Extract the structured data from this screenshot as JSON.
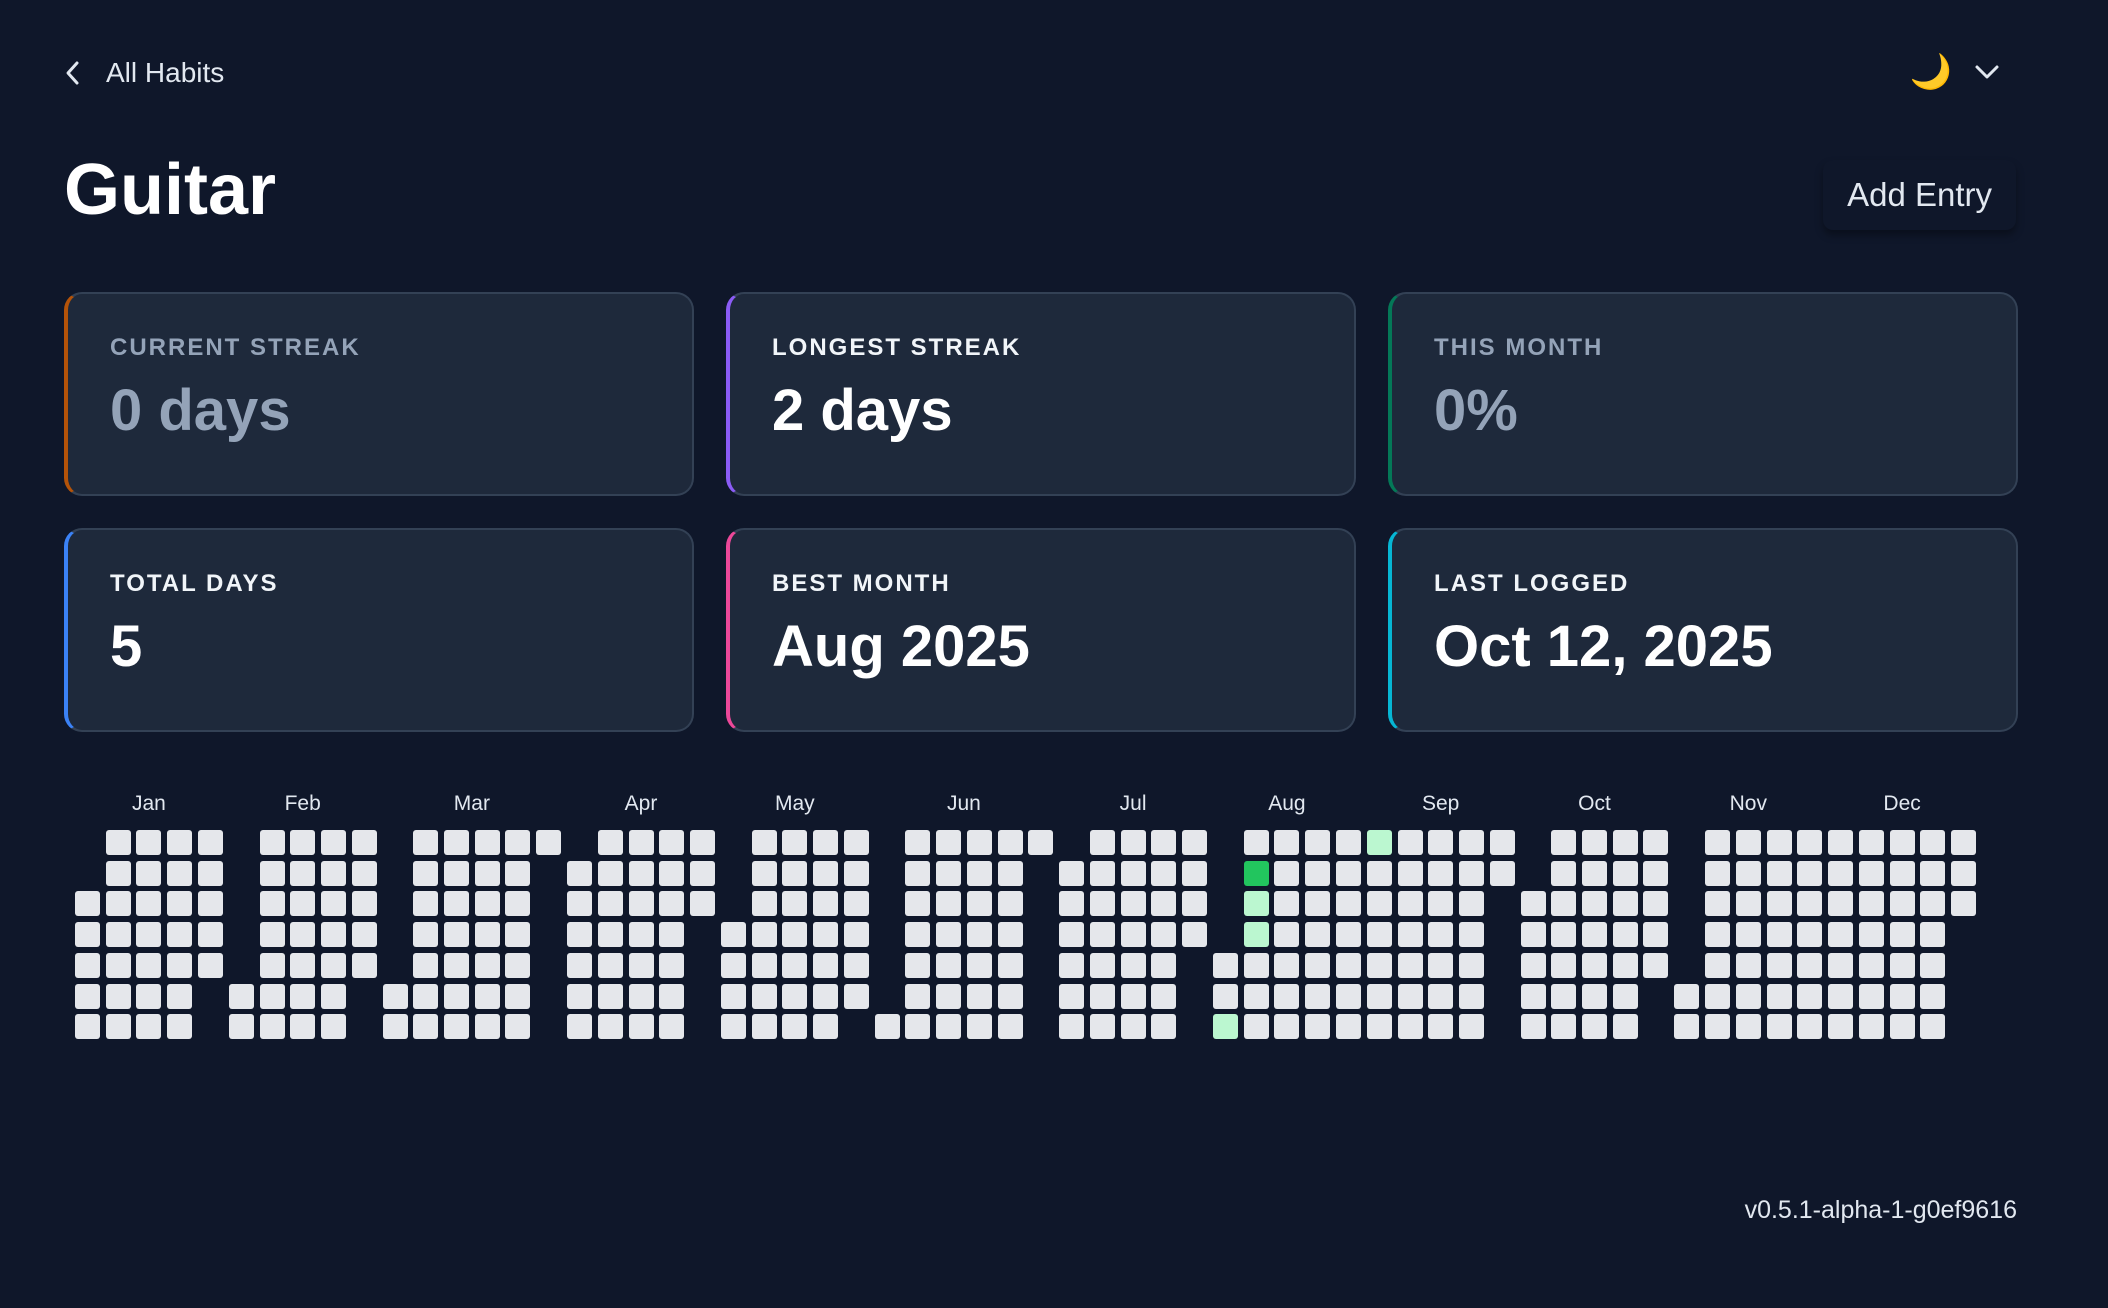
{
  "nav": {
    "back_label": "All Habits",
    "back_icon": "chevron-left-icon"
  },
  "theme": {
    "icon": "🌙",
    "icon_name": "moon-icon",
    "dropdown_icon": "chevron-down-icon"
  },
  "header": {
    "title": "Guitar",
    "add_entry_label": "Add Entry"
  },
  "stats": [
    {
      "key": "current-streak",
      "label": "CURRENT STREAK",
      "value": "0 days",
      "accent": "#b45309",
      "muted": true
    },
    {
      "key": "longest-streak",
      "label": "LONGEST STREAK",
      "value": "2 days",
      "accent": "#8b5cf6",
      "muted": false
    },
    {
      "key": "this-month",
      "label": "THIS MONTH",
      "value": "0%",
      "accent": "#047857",
      "muted": true
    },
    {
      "key": "total-days",
      "label": "TOTAL DAYS",
      "value": "5",
      "accent": "#3b82f6",
      "muted": false
    },
    {
      "key": "best-month",
      "label": "BEST MONTH",
      "value": "Aug 2025",
      "accent": "#ec4899",
      "muted": false
    },
    {
      "key": "last-logged",
      "label": "LAST LOGGED",
      "value": "Oct 12, 2025",
      "accent": "#06b6d4",
      "muted": false
    }
  ],
  "heatmap": {
    "year": 2025,
    "months": [
      "Jan",
      "Feb",
      "Mar",
      "Apr",
      "May",
      "Jun",
      "Jul",
      "Aug",
      "Sep",
      "Oct",
      "Nov",
      "Dec"
    ],
    "colors": {
      "empty": "#e5e7eb",
      "light": "#bbf7d0",
      "full": "#22c55e"
    },
    "entries": [
      {
        "date": "2025-08-03",
        "level": "light"
      },
      {
        "date": "2025-08-05",
        "level": "full"
      },
      {
        "date": "2025-08-06",
        "level": "light"
      },
      {
        "date": "2025-08-07",
        "level": "light"
      },
      {
        "date": "2025-09-01",
        "level": "light"
      }
    ]
  },
  "footer": {
    "version": "v0.5.1-alpha-1-g0ef9616"
  }
}
